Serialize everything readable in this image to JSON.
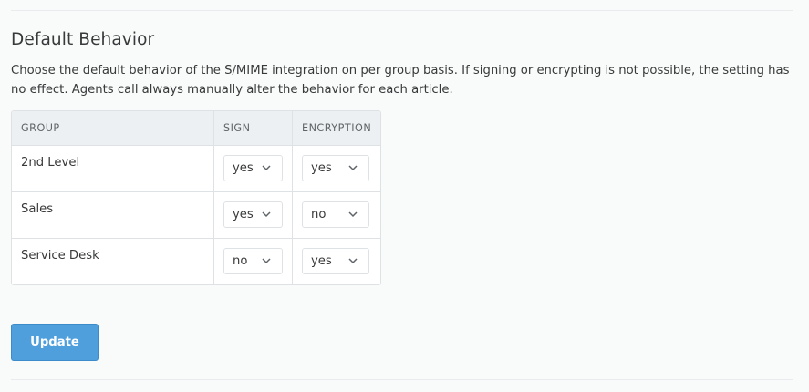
{
  "section": {
    "title": "Default Behavior",
    "description": "Choose the default behavior of the S/MIME integration on per group basis. If signing or encrypting is not possible, the setting has no effect. Agents call always manually alter the behavior for each article."
  },
  "table": {
    "headers": {
      "group": "GROUP",
      "sign": "SIGN",
      "encryption": "ENCRYPTION"
    },
    "rows": [
      {
        "group": "2nd Level",
        "sign": "yes",
        "encryption": "yes"
      },
      {
        "group": "Sales",
        "sign": "yes",
        "encryption": "no"
      },
      {
        "group": "Service Desk",
        "sign": "no",
        "encryption": "yes"
      }
    ]
  },
  "actions": {
    "update_label": "Update"
  },
  "icons": {
    "dropdown": "chevron-down-icon"
  },
  "colors": {
    "primary_button": "#4f9fdd",
    "header_background": "#ecf0f2",
    "page_background": "#f9fafa"
  }
}
